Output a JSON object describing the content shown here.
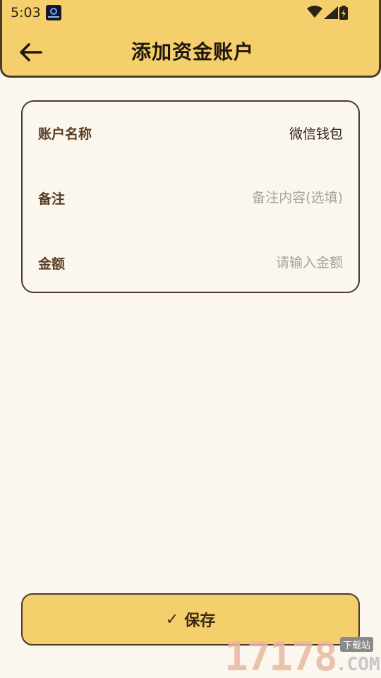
{
  "status_bar": {
    "time": "5:03"
  },
  "header": {
    "title": "添加资金账户",
    "back_icon": "arrow-left-icon"
  },
  "form": {
    "fields": [
      {
        "label": "账户名称",
        "value": "微信钱包",
        "placeholder": ""
      },
      {
        "label": "备注",
        "value": "",
        "placeholder": "备注内容(选填)"
      },
      {
        "label": "金额",
        "value": "",
        "placeholder": "请输入金额"
      }
    ]
  },
  "save_button": {
    "check": "✓",
    "label": "保存"
  },
  "watermark": {
    "number": "17178",
    "domain": ".COM",
    "download": "下载站"
  },
  "colors": {
    "accent": "#F5CF6B",
    "background": "#FBF6EE",
    "border": "#4A3A2C",
    "placeholder": "#A8A29B"
  }
}
